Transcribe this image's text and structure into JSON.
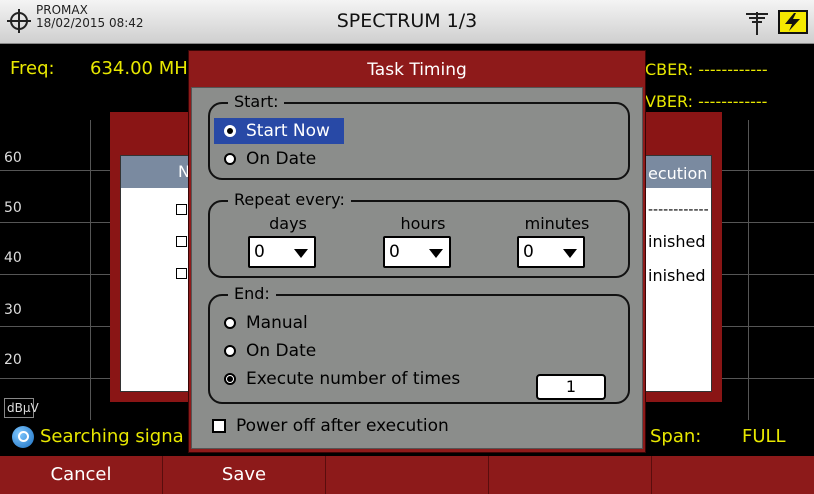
{
  "topbar": {
    "brand": "PROMAX",
    "datetime": "18/02/2015 08:42",
    "title": "SPECTRUM 1/3",
    "icons": [
      "crosshair-icon",
      "antenna-icon",
      "battery-charging-icon"
    ]
  },
  "measure": {
    "freq_label": "Freq:",
    "freq_value": "634.00 MH",
    "cber": "CBER: ------------",
    "vber": "VBER: ------------"
  },
  "plot": {
    "y_ticks": [
      "60",
      "50",
      "40",
      "30",
      "20"
    ],
    "unit": "dBμV"
  },
  "background_dialog": {
    "header_partial": "N",
    "execution_header": "ecution",
    "rows": [
      "------------",
      "inished",
      "inished"
    ]
  },
  "status": {
    "search_text": "Searching signa",
    "span_label": "Span:",
    "span_value": "FULL"
  },
  "softkeys": [
    "Cancel",
    "Save",
    "",
    "",
    ""
  ],
  "modal": {
    "title": "Task Timing",
    "start": {
      "legend": "Start:",
      "options": [
        {
          "label": "Start Now",
          "selected": true
        },
        {
          "label": "On Date",
          "selected": false
        }
      ]
    },
    "repeat": {
      "legend": "Repeat every:",
      "fields": [
        {
          "label": "days",
          "value": "0"
        },
        {
          "label": "hours",
          "value": "0"
        },
        {
          "label": "minutes",
          "value": "0"
        }
      ]
    },
    "end": {
      "legend": "End:",
      "options": [
        {
          "label": "Manual",
          "selected": false
        },
        {
          "label": "On Date",
          "selected": false
        },
        {
          "label": "Execute number of times",
          "selected": true
        }
      ],
      "times_value": "1"
    },
    "power_off": {
      "label": "Power off after execution",
      "checked": false
    }
  },
  "colors": {
    "accent_red": "#8e1a1a",
    "highlight_blue": "#2849a6",
    "text_yellow": "#e8e800"
  }
}
